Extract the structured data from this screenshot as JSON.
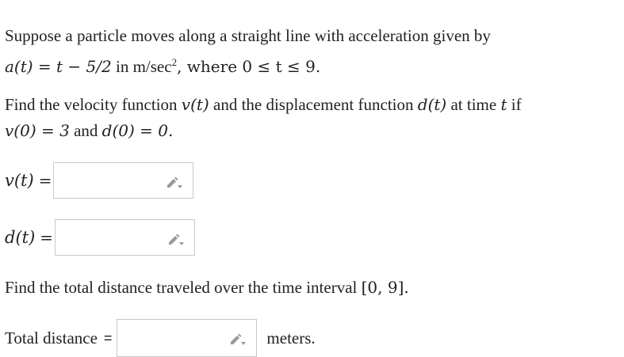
{
  "problem": {
    "intro_text": "Suppose a particle moves along a straight line with acceleration given by",
    "accel_expr": "a(t) = t − 5/2",
    "accel_units_pre": " in m/sec",
    "accel_units_sup": "2",
    "accel_domain": ", where 0 ≤ t ≤ 9.",
    "find_text_1": "Find the velocity function ",
    "v_func": "v(t)",
    "find_text_2": " and the displacement function ",
    "d_func": "d(t)",
    "find_text_3": " at time ",
    "t_var": "t",
    "find_text_4": " if",
    "initial_conditions": "v(0) = 3",
    "and_text": " and ",
    "initial_conditions_2": "d(0) = 0.",
    "distance_text": "Find the total distance traveled over the time interval ",
    "interval": "[0, 9]."
  },
  "answers": {
    "velocity_label": "v(t)",
    "velocity_eq": "=",
    "velocity_value": "",
    "displacement_label": "d(t)",
    "displacement_eq": "=",
    "displacement_value": "",
    "total_label": "Total distance",
    "total_eq": "=",
    "total_value": "",
    "total_unit": "meters."
  },
  "icons": {
    "pencil": "pencil-icon"
  },
  "colors": {
    "text": "#222222",
    "box_border": "#c8c8c8",
    "icon": "#9a9a9a"
  }
}
